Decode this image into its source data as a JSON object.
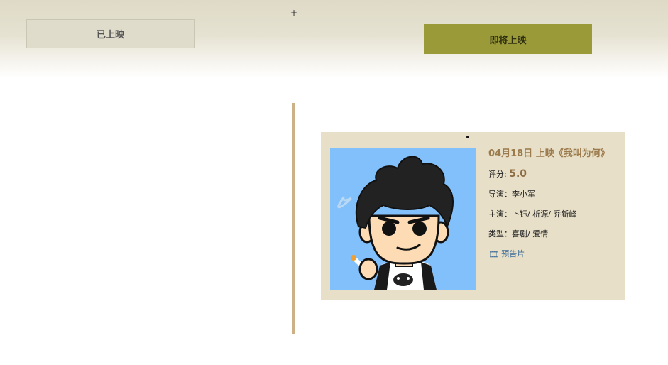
{
  "header": {
    "plus": "+",
    "tab_released": "已上映",
    "tab_upcoming": "即将上映"
  },
  "movie": {
    "title": "04月18日 上映《我叫为何》",
    "rating_label": "评分:",
    "rating_value": "5.0",
    "director_label": "导演：",
    "director": "李小军",
    "cast_label": "主演：",
    "cast": "卜钰/ 析源/ 乔新峰",
    "genre_label": "类型：",
    "genre": "喜剧/ 爱情",
    "trailer_icon": "film-icon",
    "trailer_label": "预告片"
  },
  "colors": {
    "tab_active": "#9a9a38",
    "card_bg": "#e7dfc7",
    "timeline": "#ccb187",
    "poster_bg": "#82c0fb",
    "title": "#9b7a4c",
    "link": "#3f6d99"
  }
}
